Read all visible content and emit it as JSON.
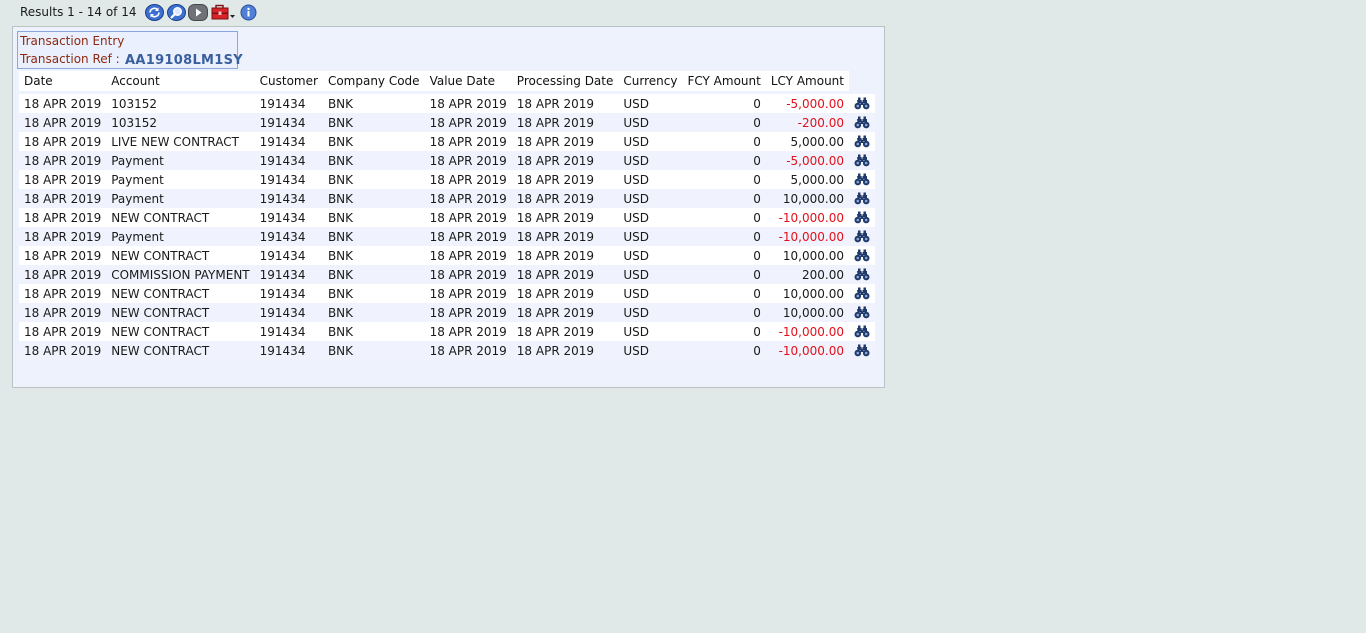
{
  "toolbar": {
    "results_text": "Results 1 - 14 of 14",
    "icons": [
      "refresh-icon",
      "search-icon",
      "play-icon",
      "toolbox-icon",
      "info-icon"
    ]
  },
  "header": {
    "line1": "Transaction Entry",
    "line2": "Transaction Ref :",
    "ref": "AA19108LM1SY"
  },
  "table": {
    "columns": [
      "Date",
      "Account",
      "Customer",
      "Company Code",
      "Value Date",
      "Processing Date",
      "Currency",
      "FCY Amount",
      "LCY Amount"
    ],
    "rows": [
      {
        "date": "18 APR 2019",
        "account": "103152",
        "customer": "191434",
        "company": "BNK",
        "value_date": "18 APR 2019",
        "processing_date": "18 APR 2019",
        "currency": "USD",
        "fcy": "0",
        "lcy": "-5,000.00",
        "negative": true
      },
      {
        "date": "18 APR 2019",
        "account": "103152",
        "customer": "191434",
        "company": "BNK",
        "value_date": "18 APR 2019",
        "processing_date": "18 APR 2019",
        "currency": "USD",
        "fcy": "0",
        "lcy": "-200.00",
        "negative": true
      },
      {
        "date": "18 APR 2019",
        "account": "LIVE NEW CONTRACT",
        "customer": "191434",
        "company": "BNK",
        "value_date": "18 APR 2019",
        "processing_date": "18 APR 2019",
        "currency": "USD",
        "fcy": "0",
        "lcy": "5,000.00",
        "negative": false
      },
      {
        "date": "18 APR 2019",
        "account": "Payment",
        "customer": "191434",
        "company": "BNK",
        "value_date": "18 APR 2019",
        "processing_date": "18 APR 2019",
        "currency": "USD",
        "fcy": "0",
        "lcy": "-5,000.00",
        "negative": true
      },
      {
        "date": "18 APR 2019",
        "account": "Payment",
        "customer": "191434",
        "company": "BNK",
        "value_date": "18 APR 2019",
        "processing_date": "18 APR 2019",
        "currency": "USD",
        "fcy": "0",
        "lcy": "5,000.00",
        "negative": false
      },
      {
        "date": "18 APR 2019",
        "account": "Payment",
        "customer": "191434",
        "company": "BNK",
        "value_date": "18 APR 2019",
        "processing_date": "18 APR 2019",
        "currency": "USD",
        "fcy": "0",
        "lcy": "10,000.00",
        "negative": false
      },
      {
        "date": "18 APR 2019",
        "account": "NEW CONTRACT",
        "customer": "191434",
        "company": "BNK",
        "value_date": "18 APR 2019",
        "processing_date": "18 APR 2019",
        "currency": "USD",
        "fcy": "0",
        "lcy": "-10,000.00",
        "negative": true
      },
      {
        "date": "18 APR 2019",
        "account": "Payment",
        "customer": "191434",
        "company": "BNK",
        "value_date": "18 APR 2019",
        "processing_date": "18 APR 2019",
        "currency": "USD",
        "fcy": "0",
        "lcy": "-10,000.00",
        "negative": true
      },
      {
        "date": "18 APR 2019",
        "account": "NEW CONTRACT",
        "customer": "191434",
        "company": "BNK",
        "value_date": "18 APR 2019",
        "processing_date": "18 APR 2019",
        "currency": "USD",
        "fcy": "0",
        "lcy": "10,000.00",
        "negative": false
      },
      {
        "date": "18 APR 2019",
        "account": "COMMISSION PAYMENT",
        "customer": "191434",
        "company": "BNK",
        "value_date": "18 APR 2019",
        "processing_date": "18 APR 2019",
        "currency": "USD",
        "fcy": "0",
        "lcy": "200.00",
        "negative": false
      },
      {
        "date": "18 APR 2019",
        "account": "NEW CONTRACT",
        "customer": "191434",
        "company": "BNK",
        "value_date": "18 APR 2019",
        "processing_date": "18 APR 2019",
        "currency": "USD",
        "fcy": "0",
        "lcy": "10,000.00",
        "negative": false
      },
      {
        "date": "18 APR 2019",
        "account": "NEW CONTRACT",
        "customer": "191434",
        "company": "BNK",
        "value_date": "18 APR 2019",
        "processing_date": "18 APR 2019",
        "currency": "USD",
        "fcy": "0",
        "lcy": "10,000.00",
        "negative": false
      },
      {
        "date": "18 APR 2019",
        "account": "NEW CONTRACT",
        "customer": "191434",
        "company": "BNK",
        "value_date": "18 APR 2019",
        "processing_date": "18 APR 2019",
        "currency": "USD",
        "fcy": "0",
        "lcy": "-10,000.00",
        "negative": true
      },
      {
        "date": "18 APR 2019",
        "account": "NEW CONTRACT",
        "customer": "191434",
        "company": "BNK",
        "value_date": "18 APR 2019",
        "processing_date": "18 APR 2019",
        "currency": "USD",
        "fcy": "0",
        "lcy": "-10,000.00",
        "negative": true
      }
    ],
    "row_action_icon": "binoculars-icon"
  },
  "colors": {
    "negative": "#e2101a",
    "header_text": "#8b2a12",
    "ref_text": "#3a5f9e",
    "icon_navy": "#1f3a6b"
  }
}
